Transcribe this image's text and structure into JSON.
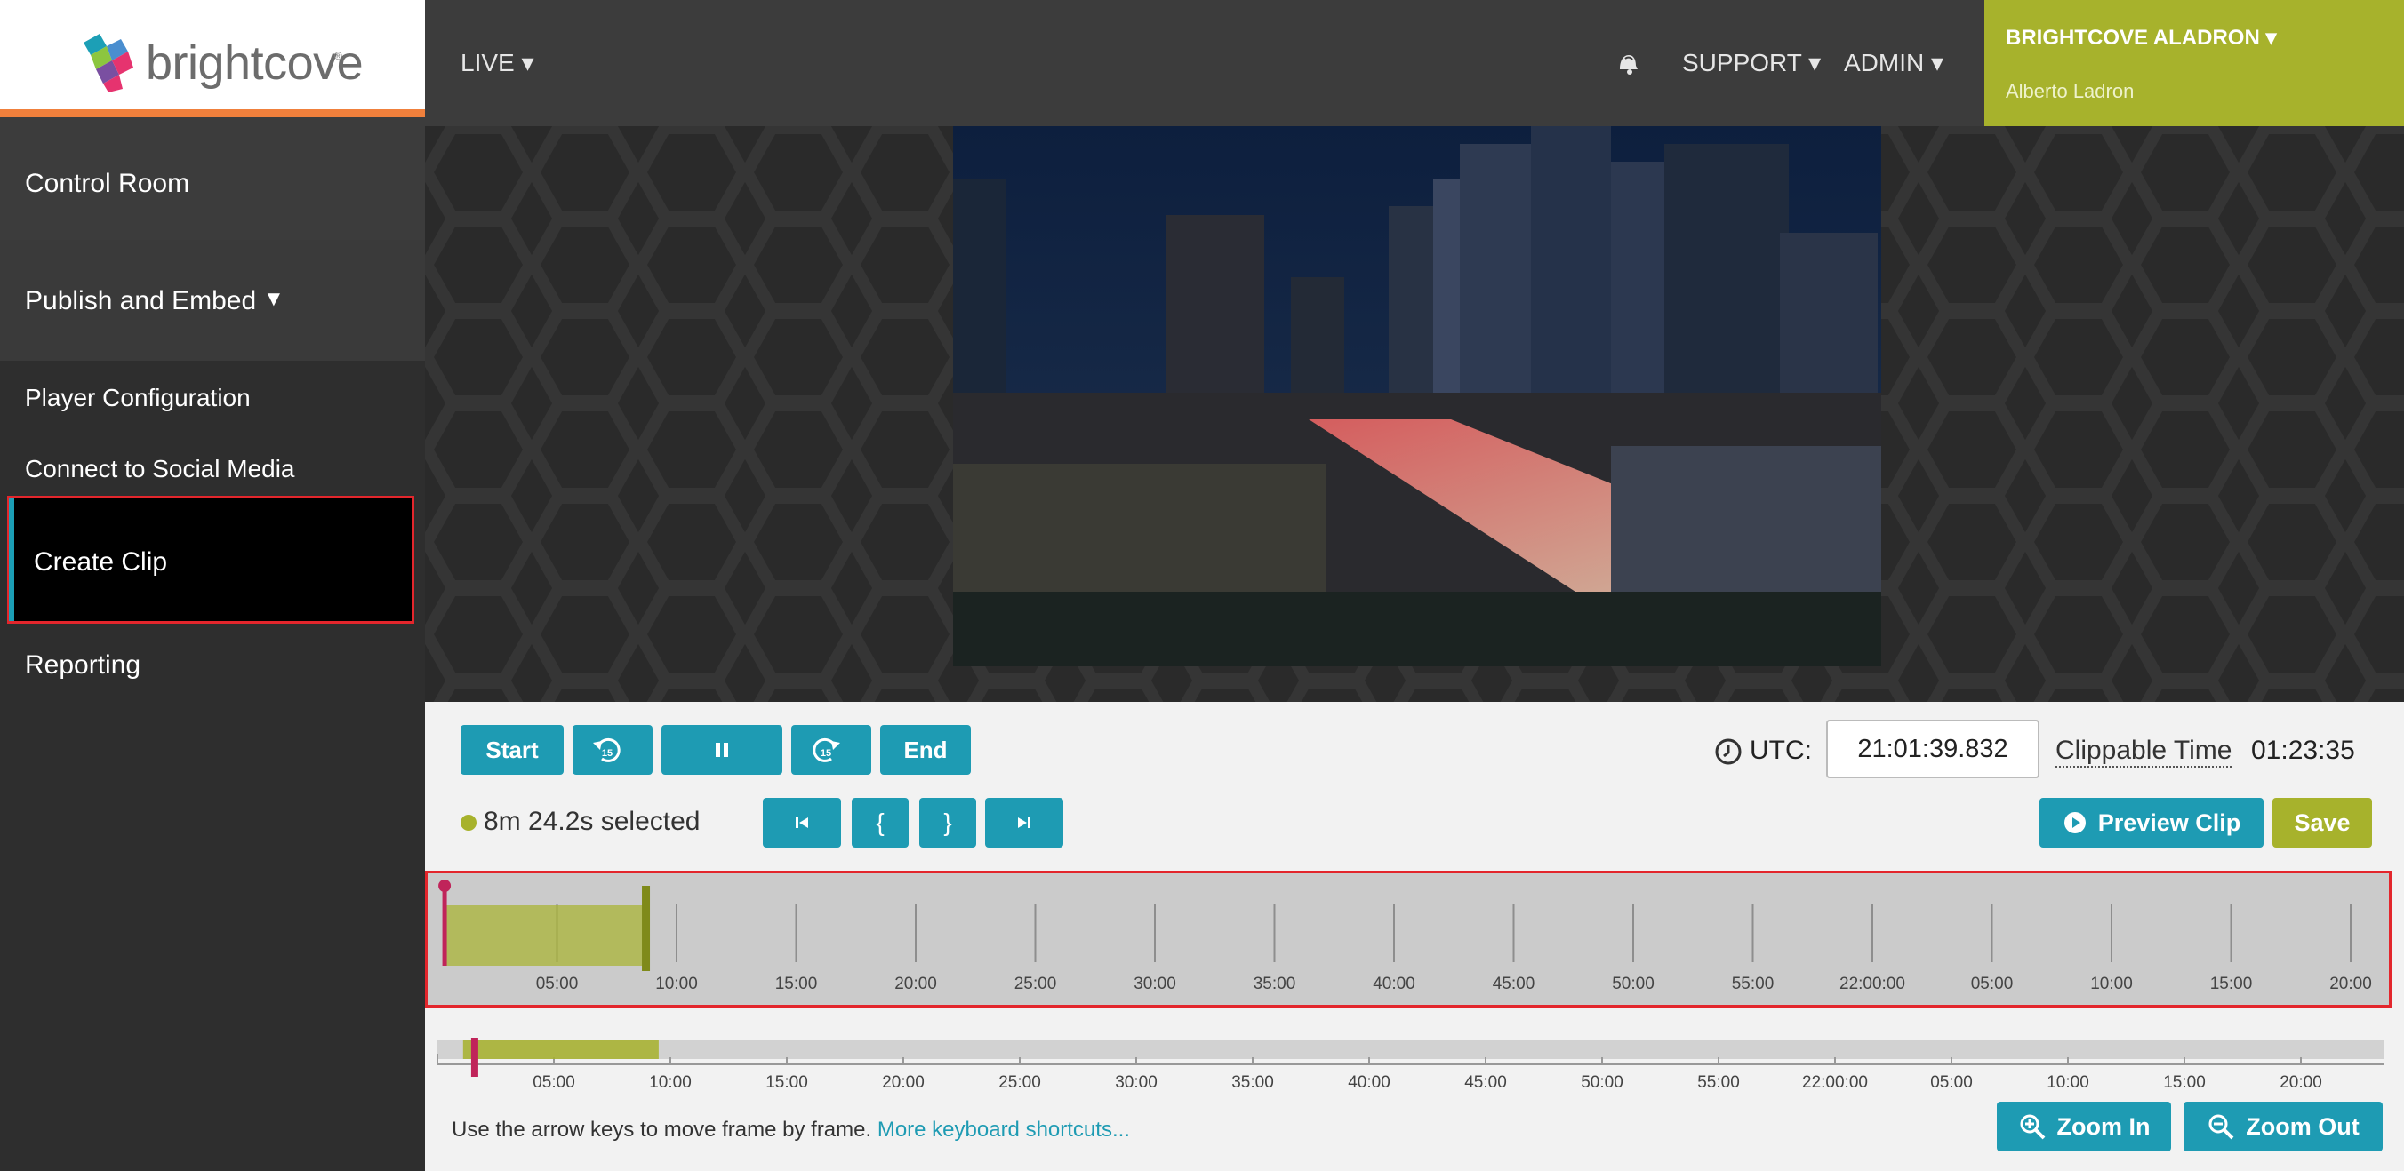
{
  "brand": {
    "name": "brightcove",
    "tm": "®"
  },
  "sidebar": {
    "control_room": "Control Room",
    "publish_embed": "Publish and Embed",
    "publish_caret": "▼",
    "sub_items": [
      "Player Configuration",
      "Connect to Social Media",
      "Create Clip"
    ],
    "reporting": "Reporting",
    "active_item": "Create Clip"
  },
  "header": {
    "live": "LIVE ▾",
    "support": "SUPPORT ▾",
    "admin": "ADMIN ▾",
    "account_name": "BRIGHTCOVE ALADRON ▾",
    "account_user": "Alberto Ladron"
  },
  "controls": {
    "start": "Start",
    "back15": "15",
    "forward15": "15",
    "end": "End",
    "utc_label": "UTC:",
    "utc_value": "21:01:39.832",
    "clippable_label": "Clippable Time",
    "clippable_value": "01:23:35",
    "selection_text": "8m 24.2s selected",
    "in_mark": "{",
    "out_mark": "}",
    "preview": "Preview Clip",
    "save": "Save"
  },
  "timeline": {
    "tick_labels": [
      "05:00",
      "10:00",
      "15:00",
      "20:00",
      "25:00",
      "30:00",
      "35:00",
      "40:00",
      "45:00",
      "50:00",
      "55:00",
      "22:00:00",
      "05:00",
      "10:00",
      "15:00",
      "20:00"
    ],
    "total_minutes": 83.6,
    "selection_start_min": 0.3,
    "selection_end_min": 8.7,
    "playhead_min": 0.3
  },
  "overview": {
    "tick_labels": [
      "05:00",
      "10:00",
      "15:00",
      "20:00",
      "25:00",
      "30:00",
      "35:00",
      "40:00",
      "45:00",
      "50:00",
      "55:00",
      "22:00:00",
      "05:00",
      "10:00",
      "15:00",
      "20:00"
    ],
    "window_start_min": 1.1,
    "window_end_min": 9.5,
    "playhead_min": 1.6
  },
  "footer": {
    "help": "Use the arrow keys to move frame by frame. ",
    "help_link": "More keyboard shortcuts...",
    "zoom_in": "Zoom In",
    "zoom_out": "Zoom Out"
  },
  "colors": {
    "accent": "#1e9bb3",
    "brand_green": "#a7b22c",
    "highlight": "#e3262c",
    "brand_orange": "#f0803c",
    "playhead": "#c0245a"
  }
}
